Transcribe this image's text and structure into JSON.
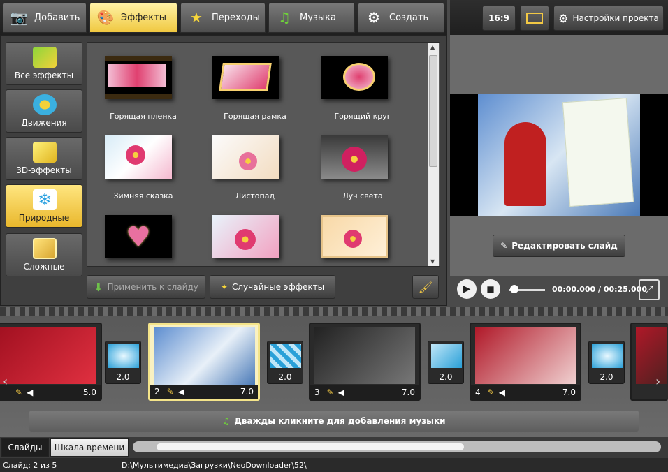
{
  "tabs": [
    {
      "label": "Добавить",
      "icon": "camera-icon"
    },
    {
      "label": "Эффекты",
      "icon": "palette-icon"
    },
    {
      "label": "Переходы",
      "icon": "star-icon"
    },
    {
      "label": "Музыка",
      "icon": "music-note-icon"
    },
    {
      "label": "Создать",
      "icon": "film-reel-icon"
    }
  ],
  "toolbar_right": {
    "aspect": "16:9",
    "settings": "Настройки проекта"
  },
  "categories": [
    {
      "label": "Все эффекты",
      "icon": "puzzle-icon"
    },
    {
      "label": "Движения",
      "icon": "move-arrows-icon"
    },
    {
      "label": "3D-эффекты",
      "icon": "cube-icon"
    },
    {
      "label": "Природные",
      "icon": "snowflake-icon"
    },
    {
      "label": "Сложные",
      "icon": "layers-icon"
    }
  ],
  "effects": [
    {
      "label": "Горящая пленка"
    },
    {
      "label": "Горящая рамка"
    },
    {
      "label": "Горящий круг"
    },
    {
      "label": "Зимняя сказка"
    },
    {
      "label": "Листопад"
    },
    {
      "label": "Луч света"
    },
    {
      "label": ""
    },
    {
      "label": ""
    },
    {
      "label": ""
    }
  ],
  "actions": {
    "apply": "Применить к слайду",
    "random": "Случайные эффекты"
  },
  "preview": {
    "edit_slide": "Редактировать слайд",
    "time": "00:00.000 / 00:25.000"
  },
  "slides": [
    {
      "num": "",
      "duration": "5.0"
    },
    {
      "num": "2",
      "duration": "7.0"
    },
    {
      "num": "3",
      "duration": "7.0"
    },
    {
      "num": "4",
      "duration": "7.0"
    }
  ],
  "transitions": [
    "2.0",
    "2.0",
    "2.0",
    "2.0"
  ],
  "music_hint": "Дважды кликните для добавления музыки",
  "bottom_tabs": {
    "slides": "Слайды",
    "timeline": "Шкала времени"
  },
  "status": {
    "slide": "Слайд: 2 из 5",
    "path": "D:\\Мультимедиа\\Загрузки\\NeoDownloader\\52\\"
  },
  "colors": {
    "accent": "#f0c840",
    "selected_border": "#f4e48a"
  }
}
